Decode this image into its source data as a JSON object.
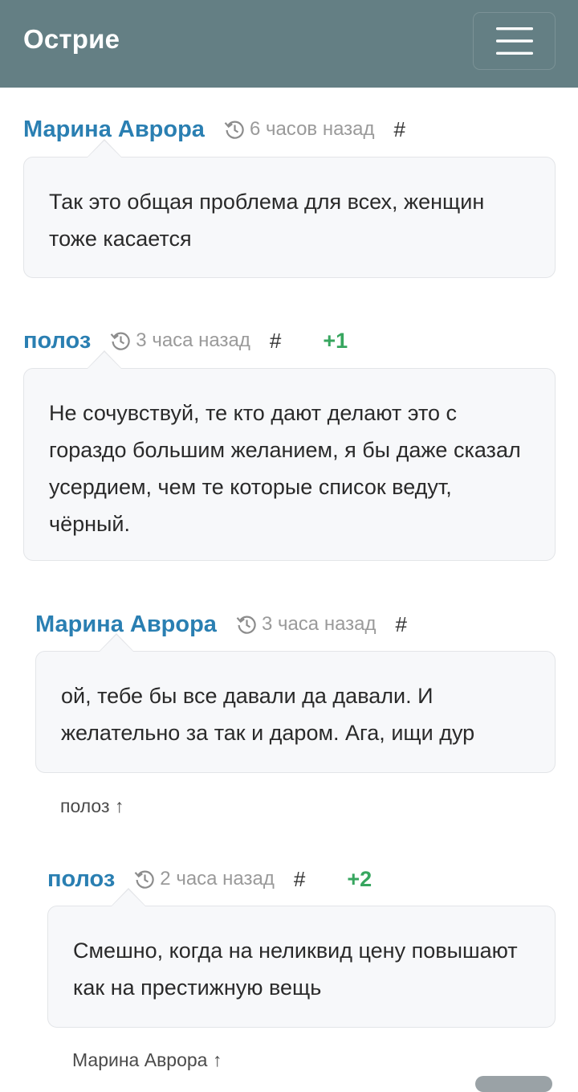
{
  "header": {
    "brand": "Острие",
    "menu_icon": "hamburger-menu-icon"
  },
  "colors": {
    "header_bg": "#647f84",
    "author": "#2a7fb2",
    "votes": "#37a65f",
    "bubble_bg": "#f7f8fa"
  },
  "comments": [
    {
      "author": "Марина Аврора",
      "time": "6 часов назад",
      "anchor": "#",
      "votes": "",
      "text": "Так это общая проблема для всех, женщин тоже касается",
      "reply_to": ""
    },
    {
      "author": "полоз",
      "time": "3 часа назад",
      "anchor": "#",
      "votes": "+1",
      "text": "Не сочувствуй, те кто дают делают это с гораздо большим желанием, я бы даже сказал усердием, чем те которые список ведут, чёрный.",
      "reply_to": ""
    },
    {
      "author": "Марина Аврора",
      "time": "3 часа назад",
      "anchor": "#",
      "votes": "",
      "text": "ой, тебе бы все давали да давали. И желательно за так и даром. Ага, ищи дур",
      "reply_to": "полоз ↑"
    },
    {
      "author": "полоз",
      "time": "2 часа назад",
      "anchor": "#",
      "votes": "+2",
      "text": "Смешно, когда на неликвид цену повышают как на престижную вещь",
      "reply_to": "Марина Аврора ↑"
    }
  ]
}
